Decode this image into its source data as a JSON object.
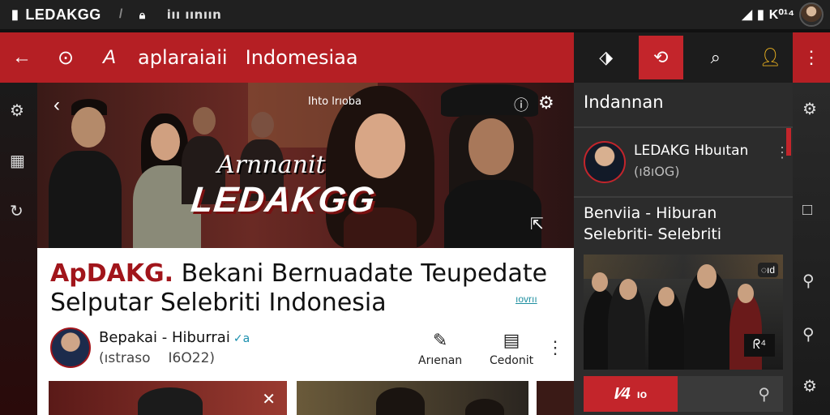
{
  "status_bar": {
    "app_name": "LEDAKGG",
    "slash": "/",
    "url_text": "iıı ıınıın",
    "right_text": "K⁰¹⁴",
    "signal_icon": "signal-icon",
    "battery_icon": "battery-icon"
  },
  "toolbar": {
    "title_part1": "aplaraiaii",
    "title_part2": "Indomesiaa",
    "back_icon": "←",
    "search_icon": "Q",
    "logo_icon": "A"
  },
  "hero": {
    "top_text": "Ihto lrıoba",
    "script_text": "Arnnanit",
    "brand_text": "LEDAKGG"
  },
  "article": {
    "title_brand": "ApDAKG.",
    "title_rest": " Bekani Bernuadate Teupedate",
    "title_line2": "Selputar Selebriti Indonesia",
    "more_link": "ıovrıı",
    "channel_name": "Bepakai - Hiburrai",
    "verified_mark": "✓a",
    "stat1": "(ıstraso",
    "stat2": "I6O22)",
    "action1_label": "Arıenan",
    "action2_label": "Cedonit"
  },
  "panel": {
    "title": "Indannan",
    "channel_name": "LEDAKG Hbuıtan",
    "subscriber_count": "(ı8ıOG)",
    "headline_line1": "Benviia - Hiburan",
    "headline_line2": "Selebriti- Selebriti",
    "image_badge_top": "◌ıd",
    "image_badge_bottom": "ᖇ⁴",
    "bar_label": "I⁄4",
    "bar_small": "ıo"
  },
  "colors": {
    "brand_red": "#b51f24",
    "accent_red": "#c3252b",
    "panel_bg": "#2c2c2c"
  }
}
